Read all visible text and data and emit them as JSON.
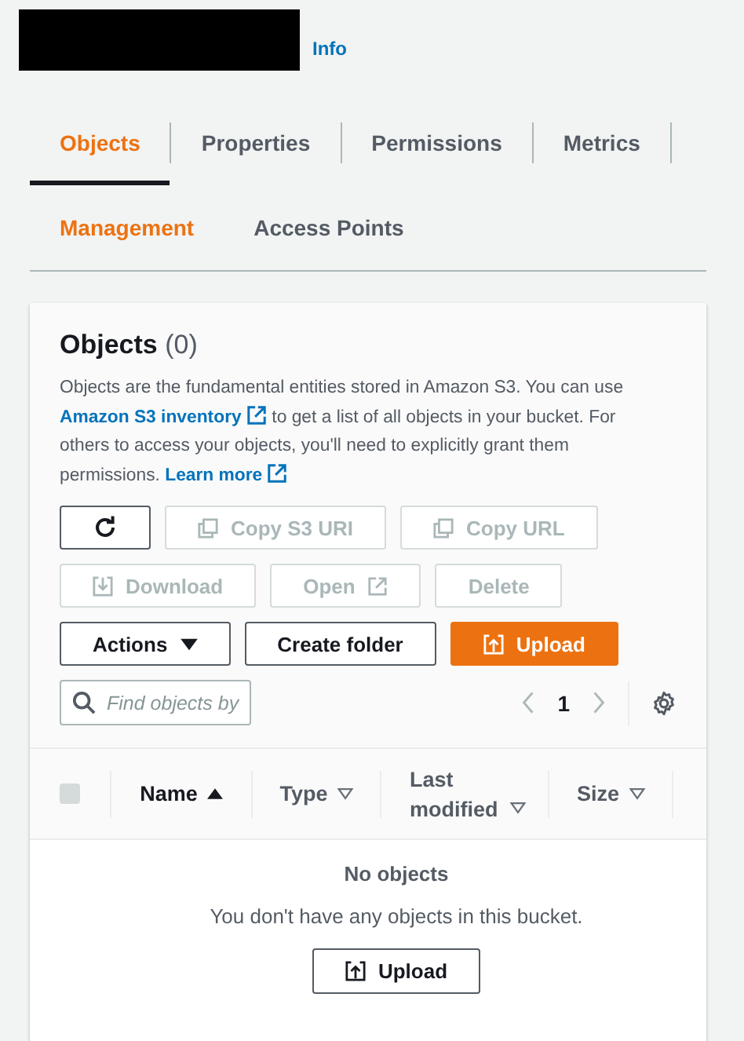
{
  "header": {
    "info_link": "Info"
  },
  "tabs": [
    {
      "label": "Objects",
      "selected": true,
      "highlighted": true
    },
    {
      "label": "Properties",
      "selected": false,
      "highlighted": false
    },
    {
      "label": "Permissions",
      "selected": false,
      "highlighted": false
    },
    {
      "label": "Metrics",
      "selected": false,
      "highlighted": false
    },
    {
      "label": "Management",
      "selected": false,
      "highlighted": true
    },
    {
      "label": "Access Points",
      "selected": false,
      "highlighted": false
    }
  ],
  "objects_panel": {
    "title": "**Objects** (0)",
    "description": [
      {
        "kind": "text",
        "text": "Objects are the fundamental entities stored in Amazon S3. You can use "
      },
      {
        "kind": "link",
        "text": "Amazon S3 inventory"
      },
      {
        "kind": "text",
        "text": " to get a list of all objects in your bucket. For others to access your objects, you'll need to explicitly grant them permissions. "
      },
      {
        "kind": "link",
        "text": "Learn more"
      }
    ],
    "button_rows": [
      [
        {
          "kind": "refresh",
          "disabled": false,
          "primary": false
        },
        {
          "kind": "copy",
          "label": "Copy S3 URI",
          "disabled": true,
          "primary": false
        },
        {
          "kind": "copy",
          "label": "Copy URL",
          "disabled": true,
          "primary": false
        }
      ],
      [
        {
          "kind": "download",
          "label": "Download",
          "disabled": true,
          "primary": false
        },
        {
          "kind": "open",
          "label": "Open",
          "disabled": true,
          "primary": false
        },
        {
          "kind": "plain",
          "label": "Delete",
          "disabled": true,
          "primary": false
        }
      ],
      [
        {
          "kind": "dropdown",
          "label": "Actions",
          "disabled": false,
          "primary": false
        },
        {
          "kind": "plain",
          "label": "Create folder",
          "disabled": false,
          "primary": false
        },
        {
          "kind": "upload",
          "label": "Upload",
          "disabled": false,
          "primary": true
        }
      ]
    ],
    "search": {
      "placeholder": "Find objects by"
    },
    "pagination": {
      "page": "1"
    },
    "table": {
      "select_all": {
        "checked": false
      },
      "columns": [
        {
          "label": "Name",
          "sorted": true
        },
        {
          "label": "Type",
          "sorted": false
        },
        {
          "label": "Last modified",
          "sorted": false
        },
        {
          "label": "Size",
          "sorted": false
        }
      ],
      "empty_title": "No objects",
      "empty_text": "You don't have any objects in this bucket.",
      "empty_button": "Upload"
    }
  }
}
